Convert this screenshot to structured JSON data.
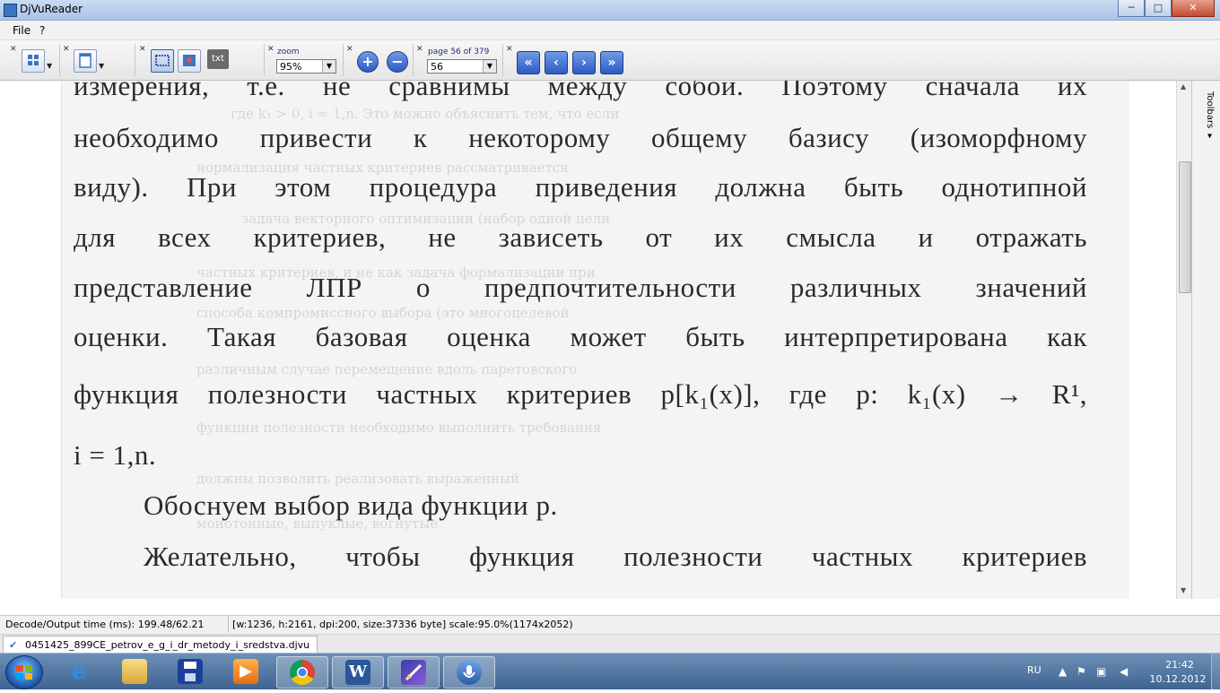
{
  "window": {
    "title": "DjVuReader",
    "minimize": "─",
    "maximize": "□",
    "close": "✕"
  },
  "menu": {
    "file": "File",
    "help": "?"
  },
  "toolbar": {
    "zoom_label": "zoom",
    "zoom_value": "95%",
    "page_label": "page 56 of 379",
    "page_value": "56",
    "txt_label": "txt",
    "zoom_in": "+",
    "zoom_out": "−",
    "nav_first": "«",
    "nav_prev": "‹",
    "nav_next": "›",
    "nav_last": "»"
  },
  "document": {
    "lines": [
      "измерения, т.е. не сравнимы между собой. Поэтому сначала их",
      "необходимо привести к некоторому общему базису (изоморфному",
      "виду). При этом процедура приведения должна быть однотипной",
      "для всех критериев, не зависеть от их смысла и отражать",
      "представление ЛПР о предпочтительности различных значений",
      "оценки. Такая базовая оценка может быть интерпретирована как",
      "функция полезности частных критериев p[k₁(x)], где p: k₁(x) → R¹,",
      "i = 1,n.",
      "Обоснуем выбор вида функции p.",
      "Желательно, чтобы функция полезности частных критериев"
    ],
    "bleed_lines": [
      "где k₁ > 0, i = 1,n. Это можно объяснить тем, что если",
      "нормализация частных критериев рассматривается",
      "задача векторного оптимизации (набор одной цели",
      "частных критериев, и не как задача формализации при",
      "способа компромиссного выбора (это многоцелевой",
      "различным случае перемещение вдоль паретовского",
      "функции полезности необходимо выполнить требования",
      "должны позволить реализовать выраженный",
      "монотонные, выпуклые, вогнутые"
    ]
  },
  "side_panel": {
    "toolbars_tab": "Toolbars ▾"
  },
  "status": {
    "decode": "Decode/Output time (ms): 199.48/62.21",
    "info": "[w:1236, h:2161, dpi:200, size:37336 byte] scale:95.0%(1174x2052)"
  },
  "tab": {
    "filename": "0451425_899CE_petrov_e_g_i_dr_metody_i_sredstva.djvu"
  },
  "taskbar": {
    "language": "RU",
    "time": "21:42",
    "date": "10.12.2012",
    "apps": [
      "internet-explorer",
      "file-explorer",
      "save-disk",
      "media-player",
      "chrome",
      "word",
      "djvu-reader",
      "speech"
    ]
  },
  "colors": {
    "accent": "#2c5bc4",
    "taskbar": "#3f6490",
    "page": "#f4f4f2"
  }
}
